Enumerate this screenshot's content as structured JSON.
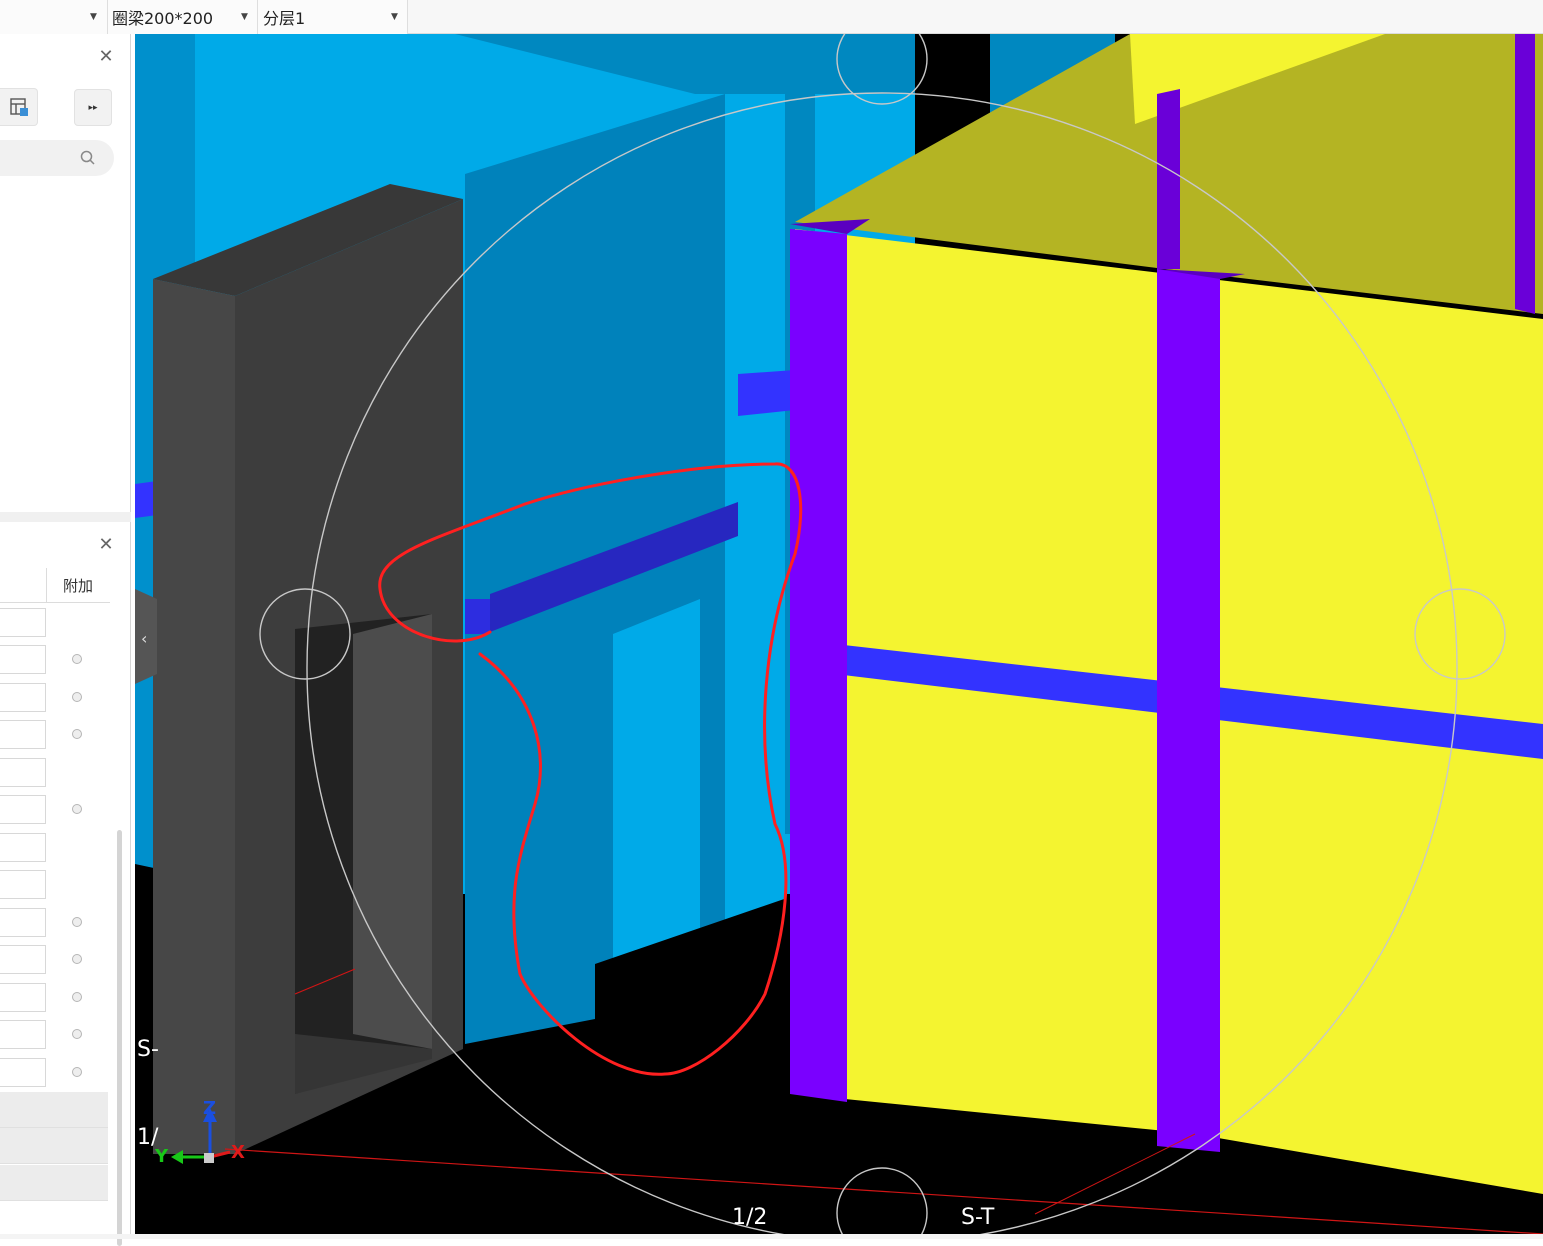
{
  "toolbar": {
    "beam_select": "圈梁200*200",
    "layer_select": "分层1"
  },
  "properties_panel": {
    "column_header": "附加"
  },
  "viewport": {
    "axis_labels": {
      "z": "Z",
      "y": "Y",
      "x": "X"
    },
    "grid_labels": {
      "left_mid": "S-",
      "left_low": "1/",
      "bottom_mid": "1/2",
      "bottom_right": "S-T"
    }
  },
  "colors": {
    "cyan_wall": "#00aae8",
    "yellow_wall": "#f4f430",
    "purple_column": "#7a00ff",
    "blue_beam": "#3333ff",
    "gray_column": "#484848",
    "red_annotation": "#ff2020"
  }
}
